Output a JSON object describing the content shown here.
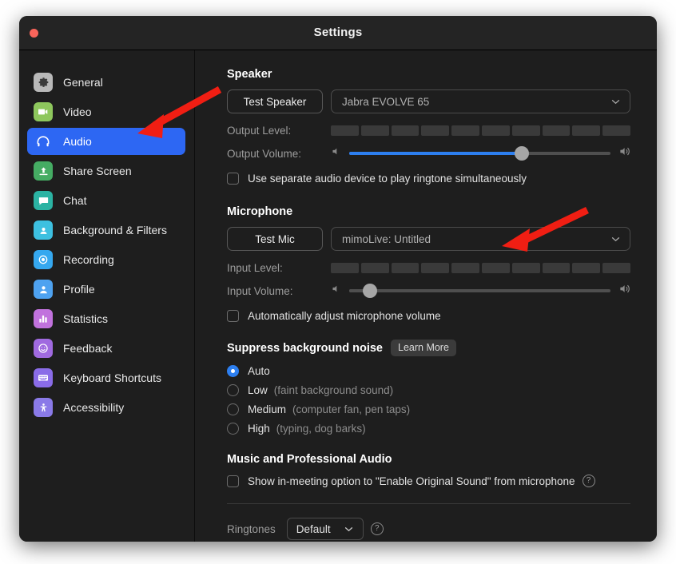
{
  "window": {
    "title": "Settings",
    "close_button": "close",
    "accent_color": "#2d67f3",
    "background_color": "#1e1e1e",
    "annotation_color": "#f01e13"
  },
  "sidebar": {
    "items": [
      {
        "label": "General",
        "icon": "gear-icon",
        "icon_color": "#b9b9b9",
        "active": false
      },
      {
        "label": "Video",
        "icon": "video-icon",
        "icon_color": "#8ec75d",
        "active": false
      },
      {
        "label": "Audio",
        "icon": "headphones-icon",
        "icon_color": "#2d67f3",
        "active": true
      },
      {
        "label": "Share Screen",
        "icon": "share-screen-icon",
        "icon_color": "#45ac63",
        "active": false
      },
      {
        "label": "Chat",
        "icon": "chat-icon",
        "icon_color": "#2bb3a3",
        "active": false
      },
      {
        "label": "Background & Filters",
        "icon": "person-frame-icon",
        "icon_color": "#3dc0e0",
        "active": false
      },
      {
        "label": "Recording",
        "icon": "record-icon",
        "icon_color": "#35a8ef",
        "active": false
      },
      {
        "label": "Profile",
        "icon": "person-icon",
        "icon_color": "#4ea2f0",
        "active": false
      },
      {
        "label": "Statistics",
        "icon": "bar-chart-icon",
        "icon_color": "#c172dd",
        "active": false
      },
      {
        "label": "Feedback",
        "icon": "smiley-icon",
        "icon_color": "#a06ae0",
        "active": false
      },
      {
        "label": "Keyboard Shortcuts",
        "icon": "keyboard-icon",
        "icon_color": "#8a6ce8",
        "active": false
      },
      {
        "label": "Accessibility",
        "icon": "accessibility-icon",
        "icon_color": "#8a7ae8",
        "active": false
      }
    ]
  },
  "speaker": {
    "heading": "Speaker",
    "test_button": "Test Speaker",
    "device": "Jabra EVOLVE 65",
    "output_level_label": "Output Level:",
    "output_level_segments": 10,
    "output_level_value": 0,
    "output_volume_label": "Output Volume:",
    "output_volume_percent": 66,
    "separate_ringtone_checkbox": "Use separate audio device to play ringtone simultaneously",
    "separate_ringtone_checked": false
  },
  "microphone": {
    "heading": "Microphone",
    "test_button": "Test Mic",
    "device": "mimoLive: Untitled",
    "input_level_label": "Input Level:",
    "input_level_segments": 10,
    "input_level_value": 0,
    "input_volume_label": "Input Volume:",
    "input_volume_percent": 8,
    "auto_adjust_checkbox": "Automatically adjust microphone volume",
    "auto_adjust_checked": false
  },
  "suppress_noise": {
    "heading": "Suppress background noise",
    "learn_more": "Learn More",
    "selected": "Auto",
    "options": [
      {
        "label": "Auto",
        "hint": "",
        "selected": true
      },
      {
        "label": "Low",
        "hint": "(faint background sound)",
        "selected": false
      },
      {
        "label": "Medium",
        "hint": "(computer fan, pen taps)",
        "selected": false
      },
      {
        "label": "High",
        "hint": "(typing, dog barks)",
        "selected": false
      }
    ]
  },
  "music_pro_audio": {
    "heading": "Music and Professional Audio",
    "original_sound_checkbox": "Show in-meeting option to \"Enable Original Sound\" from microphone",
    "original_sound_checked": false,
    "help_icon": "question-mark-icon"
  },
  "ringtones": {
    "label": "Ringtones",
    "value": "Default",
    "help_icon": "question-mark-icon"
  },
  "annotations": [
    {
      "name": "arrow-to-audio-tab",
      "description": "red arrow pointing to Audio sidebar item"
    },
    {
      "name": "arrow-to-microphone-device",
      "description": "red arrow pointing to microphone device dropdown"
    }
  ]
}
